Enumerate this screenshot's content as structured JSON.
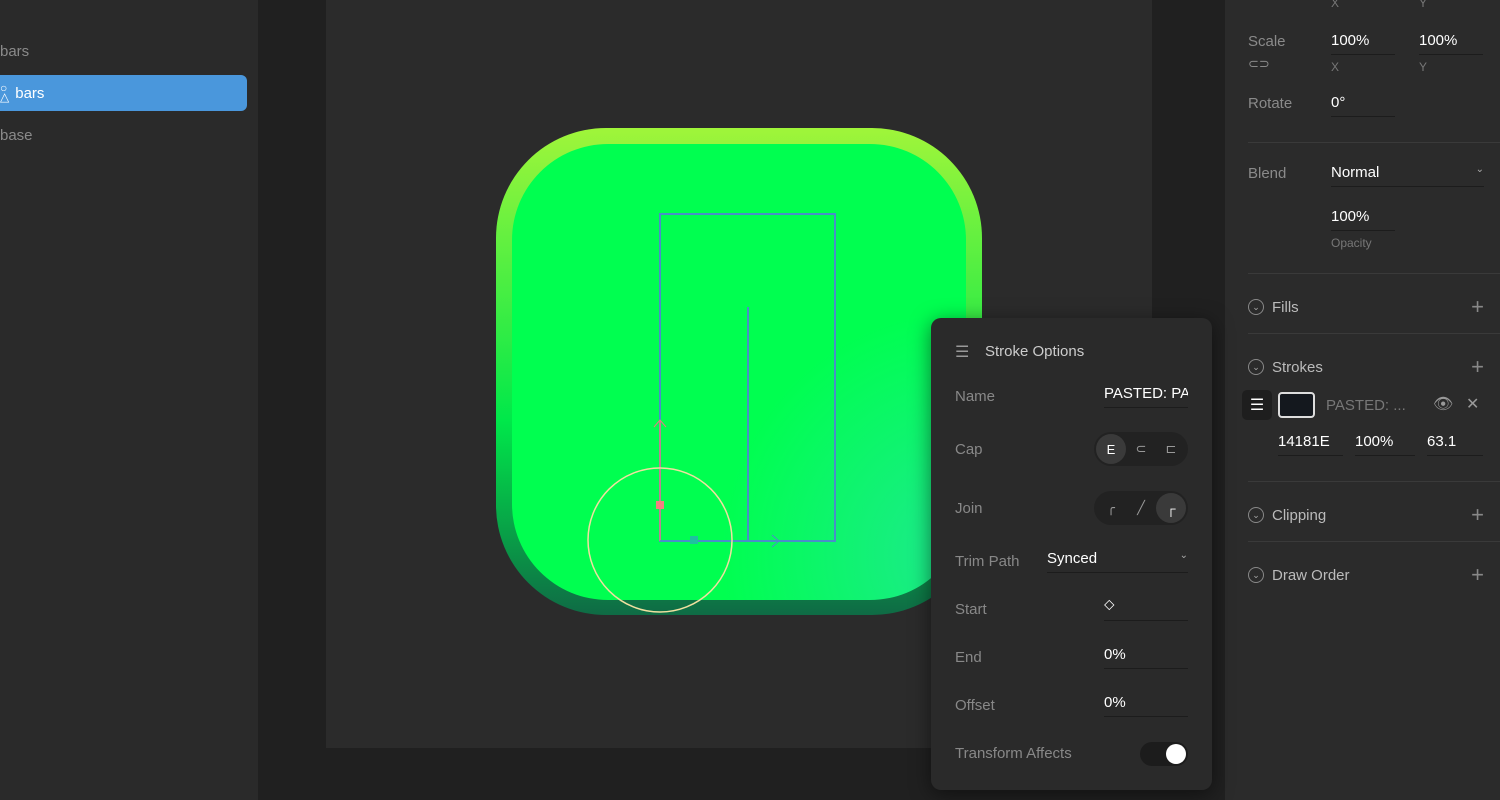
{
  "layers": {
    "items": [
      {
        "label": "bars"
      },
      {
        "label": "bars",
        "selected": true
      },
      {
        "label": "base"
      }
    ]
  },
  "transform": {
    "x_label": "X",
    "y_label": "Y",
    "scale_label": "Scale",
    "scale_x": "100%",
    "scale_y": "100%",
    "rotate_label": "Rotate",
    "rotate": "0°"
  },
  "appearance": {
    "blend_label": "Blend",
    "blend": "Normal",
    "opacity": "100%",
    "opacity_label": "Opacity"
  },
  "sections": {
    "fills": "Fills",
    "strokes": "Strokes",
    "clipping": "Clipping",
    "draw_order": "Draw Order"
  },
  "stroke_item": {
    "name": "PASTED: ...",
    "color": "14181E",
    "opacity": "100%",
    "thickness": "63.1",
    "swatch": "#14181e"
  },
  "stroke_options": {
    "title": "Stroke Options",
    "name_label": "Name",
    "name": "PASTED: PA",
    "cap_label": "Cap",
    "join_label": "Join",
    "trim_label": "Trim Path",
    "trim": "Synced",
    "start_label": "Start",
    "end_label": "End",
    "end": "0%",
    "offset_label": "Offset",
    "offset": "0%",
    "transform_label": "Transform Affects",
    "transform_on": true
  },
  "colors": {
    "accent": "#4a97dc",
    "green": "#00ff50"
  }
}
